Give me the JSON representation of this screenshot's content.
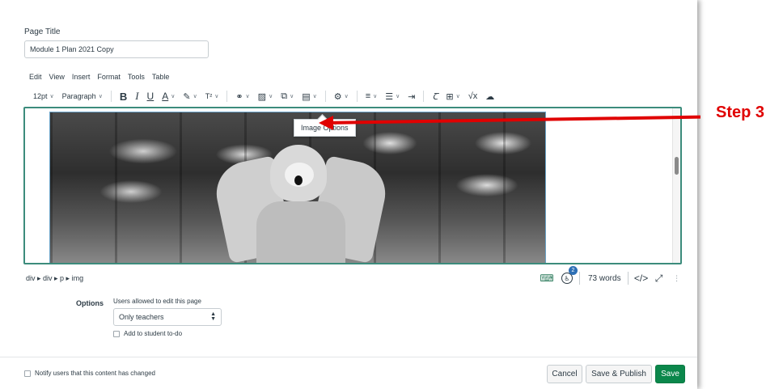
{
  "page_title": {
    "label": "Page Title",
    "value": "Module 1 Plan 2021 Copy"
  },
  "menubar": [
    "Edit",
    "View",
    "Insert",
    "Format",
    "Tools",
    "Table"
  ],
  "toolbar": {
    "font_size": "12pt",
    "block_format": "Paragraph",
    "bold_glyph": "B",
    "italic_glyph": "I",
    "underline_glyph": "U",
    "text_color_glyph": "A",
    "superscript_glyph": "T²"
  },
  "image_popup": {
    "label": "Image Options"
  },
  "annotation": {
    "step_label": "Step 3",
    "color": "#e00000"
  },
  "statusbar": {
    "path": "div ▸ div ▸ p ▸ img",
    "a11y_badge_count": "2",
    "word_count": "73 words",
    "html_toggle": "</>"
  },
  "options": {
    "label": "Options",
    "hint": "Users allowed to edit this page",
    "selected": "Only teachers",
    "todo_label": "Add to student to-do"
  },
  "footer": {
    "notify_label": "Notify users that this content has changed",
    "cancel_label": "Cancel",
    "save_publish_label": "Save & Publish",
    "save_label": "Save"
  },
  "colors": {
    "editor_border": "#3c8c7c",
    "save_button": "#0b874b",
    "text": "#2d3b45"
  }
}
